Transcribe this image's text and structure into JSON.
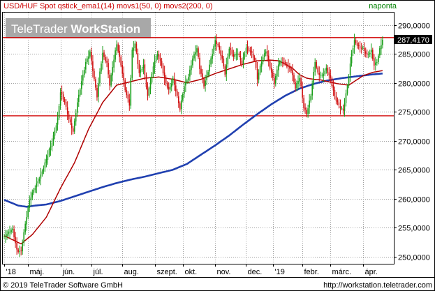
{
  "header": {
    "title": "USD/HUF Spot qstick_ema1(14) movs1(50, 0) movs2(200, 0)",
    "timeframe": "naponta"
  },
  "watermark": {
    "brand_regular": "TeleTrader ",
    "brand_bold": "WorkStation"
  },
  "footer": {
    "copyright": "© 2019 TeleTrader Software GmbH",
    "url": "http://workstation.teletrader.com"
  },
  "colors": {
    "frame": "#000000",
    "grid": "#a0a0a0",
    "up": "#1a9e1a",
    "down": "#d01010",
    "ma50": "#b00000",
    "ma200": "#2040b0",
    "hlines": "#d00000",
    "title_text": "#cc0000",
    "timeframe_text": "#008000",
    "watermark_bg": "#a8a8a8"
  },
  "chart_data": {
    "type": "candlestick",
    "title": "USD/HUF Spot qstick_ema1(14) movs1(50, 0) movs2(200, 0)",
    "ylim": [
      249,
      292
    ],
    "yticks": [
      250,
      255,
      260,
      265,
      270,
      275,
      280,
      285,
      290
    ],
    "ytick_labels": [
      "250,0000",
      "255,0000",
      "260,0000",
      "265,0000",
      "270,0000",
      "275,0000",
      "280,0000",
      "285,0000",
      "290,0000"
    ],
    "xlim": [
      0,
      276
    ],
    "xtick_labels": [
      {
        "label": "'18",
        "i": 0
      },
      {
        "label": "máj.",
        "i": 17
      },
      {
        "label": "jún.",
        "i": 40
      },
      {
        "label": "júl.",
        "i": 62
      },
      {
        "label": "aug.",
        "i": 84
      },
      {
        "label": "szept.",
        "i": 107
      },
      {
        "label": "okt.",
        "i": 127
      },
      {
        "label": "nov.",
        "i": 150
      },
      {
        "label": "dec.",
        "i": 172
      },
      {
        "label": "'19",
        "i": 191
      },
      {
        "label": "febr.",
        "i": 212
      },
      {
        "label": "márc.",
        "i": 232
      },
      {
        "label": "ápr.",
        "i": 255
      }
    ],
    "last_value": 287.417,
    "last_value_label": "287,4170",
    "resistance": 287.8,
    "support": 274.3,
    "close_keypoints": [
      [
        0,
        253.4
      ],
      [
        6,
        254.6
      ],
      [
        9,
        251.2
      ],
      [
        12,
        251.0
      ],
      [
        14,
        254.2
      ],
      [
        18,
        259.6
      ],
      [
        22,
        262.0
      ],
      [
        26,
        264.2
      ],
      [
        30,
        266.8
      ],
      [
        34,
        269.6
      ],
      [
        38,
        273.8
      ],
      [
        40,
        278.6
      ],
      [
        43,
        276.8
      ],
      [
        46,
        273.6
      ],
      [
        49,
        271.4
      ],
      [
        52,
        276.6
      ],
      [
        55,
        280.4
      ],
      [
        58,
        283.6
      ],
      [
        61,
        285.2
      ],
      [
        64,
        280.4
      ],
      [
        66,
        277.6
      ],
      [
        68,
        282.0
      ],
      [
        70,
        285.2
      ],
      [
        73,
        283.4
      ],
      [
        75,
        279.6
      ],
      [
        77,
        282.6
      ],
      [
        80,
        286.6
      ],
      [
        83,
        283.2
      ],
      [
        86,
        279.0
      ],
      [
        89,
        276.2
      ],
      [
        91,
        285.4
      ],
      [
        93,
        286.6
      ],
      [
        96,
        281.6
      ],
      [
        99,
        283.2
      ],
      [
        102,
        277.8
      ],
      [
        105,
        281.4
      ],
      [
        107,
        283.8
      ],
      [
        109,
        284.8
      ],
      [
        112,
        283.0
      ],
      [
        114,
        280.8
      ],
      [
        117,
        278.8
      ],
      [
        120,
        280.6
      ],
      [
        123,
        277.4
      ],
      [
        125,
        275.4
      ],
      [
        128,
        279.6
      ],
      [
        131,
        281.2
      ],
      [
        134,
        284.2
      ],
      [
        137,
        285.8
      ],
      [
        139,
        282.4
      ],
      [
        142,
        279.6
      ],
      [
        145,
        282.2
      ],
      [
        148,
        285.2
      ],
      [
        150,
        287.2
      ],
      [
        152,
        286.2
      ],
      [
        155,
        284.0
      ],
      [
        157,
        281.6
      ],
      [
        160,
        286.2
      ],
      [
        163,
        284.6
      ],
      [
        166,
        285.0
      ],
      [
        169,
        283.2
      ],
      [
        172,
        286.2
      ],
      [
        175,
        285.6
      ],
      [
        178,
        284.0
      ],
      [
        180,
        280.6
      ],
      [
        183,
        283.6
      ],
      [
        186,
        285.6
      ],
      [
        189,
        282.8
      ],
      [
        192,
        280.0
      ],
      [
        195,
        283.2
      ],
      [
        198,
        283.6
      ],
      [
        201,
        283.0
      ],
      [
        204,
        282.4
      ],
      [
        207,
        279.2
      ],
      [
        210,
        280.8
      ],
      [
        213,
        275.6
      ],
      [
        215,
        274.6
      ],
      [
        218,
        278.0
      ],
      [
        221,
        283.8
      ],
      [
        223,
        281.6
      ],
      [
        226,
        281.0
      ],
      [
        229,
        282.4
      ],
      [
        232,
        280.8
      ],
      [
        235,
        277.8
      ],
      [
        238,
        276.0
      ],
      [
        241,
        275.0
      ],
      [
        244,
        279.4
      ],
      [
        247,
        285.2
      ],
      [
        249,
        287.4
      ],
      [
        252,
        286.2
      ],
      [
        255,
        285.8
      ],
      [
        258,
        284.6
      ],
      [
        261,
        285.6
      ],
      [
        263,
        283.2
      ],
      [
        265,
        283.8
      ],
      [
        267,
        285.8
      ],
      [
        269,
        287.417
      ]
    ],
    "ma50_keypoints": [
      [
        0,
        253.6
      ],
      [
        12,
        252.2
      ],
      [
        20,
        253.8
      ],
      [
        30,
        256.8
      ],
      [
        40,
        261.8
      ],
      [
        50,
        266.2
      ],
      [
        60,
        272.0
      ],
      [
        70,
        276.6
      ],
      [
        80,
        279.6
      ],
      [
        90,
        280.2
      ],
      [
        100,
        280.8
      ],
      [
        110,
        281.0
      ],
      [
        120,
        280.6
      ],
      [
        130,
        280.0
      ],
      [
        140,
        280.6
      ],
      [
        150,
        281.6
      ],
      [
        160,
        282.4
      ],
      [
        170,
        283.2
      ],
      [
        180,
        283.8
      ],
      [
        190,
        283.9
      ],
      [
        195,
        283.8
      ],
      [
        200,
        283.2
      ],
      [
        205,
        282.5
      ],
      [
        210,
        281.4
      ],
      [
        215,
        280.8
      ],
      [
        220,
        280.6
      ],
      [
        225,
        280.5
      ],
      [
        230,
        280.2
      ],
      [
        238,
        279.8
      ],
      [
        245,
        279.6
      ],
      [
        250,
        280.4
      ],
      [
        255,
        281.2
      ],
      [
        262,
        281.8
      ],
      [
        269,
        282.1
      ]
    ],
    "ma200_keypoints": [
      [
        0,
        259.8
      ],
      [
        10,
        258.8
      ],
      [
        16,
        258.6
      ],
      [
        22,
        258.8
      ],
      [
        30,
        259.0
      ],
      [
        40,
        259.6
      ],
      [
        50,
        260.4
      ],
      [
        60,
        261.2
      ],
      [
        70,
        262.0
      ],
      [
        80,
        262.7
      ],
      [
        90,
        263.3
      ],
      [
        100,
        263.8
      ],
      [
        110,
        264.4
      ],
      [
        120,
        265.0
      ],
      [
        130,
        266.0
      ],
      [
        140,
        267.6
      ],
      [
        150,
        269.2
      ],
      [
        160,
        270.9
      ],
      [
        170,
        272.8
      ],
      [
        180,
        274.6
      ],
      [
        190,
        276.3
      ],
      [
        200,
        277.8
      ],
      [
        210,
        279.0
      ],
      [
        220,
        279.8
      ],
      [
        230,
        280.4
      ],
      [
        240,
        280.8
      ],
      [
        250,
        281.1
      ],
      [
        260,
        281.4
      ],
      [
        269,
        281.6
      ]
    ]
  }
}
